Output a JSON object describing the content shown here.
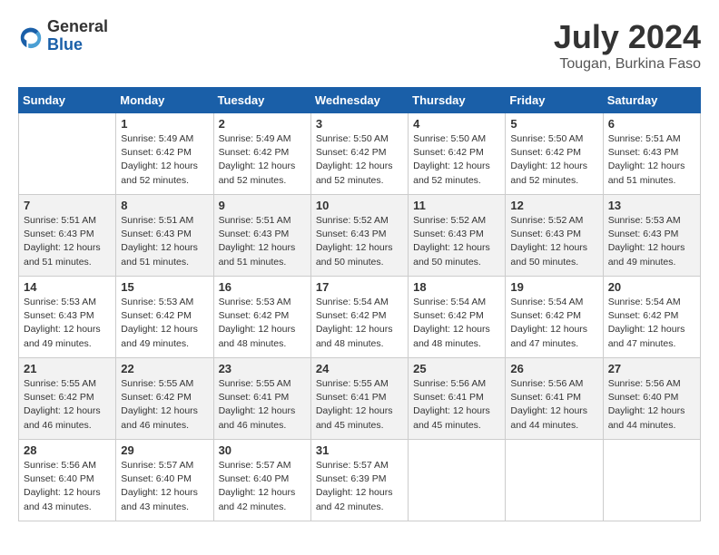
{
  "header": {
    "logo_line1": "General",
    "logo_line2": "Blue",
    "month_year": "July 2024",
    "location": "Tougan, Burkina Faso"
  },
  "days_of_week": [
    "Sunday",
    "Monday",
    "Tuesday",
    "Wednesday",
    "Thursday",
    "Friday",
    "Saturday"
  ],
  "weeks": [
    [
      {
        "day": "",
        "info": ""
      },
      {
        "day": "1",
        "info": "Sunrise: 5:49 AM\nSunset: 6:42 PM\nDaylight: 12 hours\nand 52 minutes."
      },
      {
        "day": "2",
        "info": "Sunrise: 5:49 AM\nSunset: 6:42 PM\nDaylight: 12 hours\nand 52 minutes."
      },
      {
        "day": "3",
        "info": "Sunrise: 5:50 AM\nSunset: 6:42 PM\nDaylight: 12 hours\nand 52 minutes."
      },
      {
        "day": "4",
        "info": "Sunrise: 5:50 AM\nSunset: 6:42 PM\nDaylight: 12 hours\nand 52 minutes."
      },
      {
        "day": "5",
        "info": "Sunrise: 5:50 AM\nSunset: 6:42 PM\nDaylight: 12 hours\nand 52 minutes."
      },
      {
        "day": "6",
        "info": "Sunrise: 5:51 AM\nSunset: 6:43 PM\nDaylight: 12 hours\nand 51 minutes."
      }
    ],
    [
      {
        "day": "7",
        "info": "Sunrise: 5:51 AM\nSunset: 6:43 PM\nDaylight: 12 hours\nand 51 minutes."
      },
      {
        "day": "8",
        "info": "Sunrise: 5:51 AM\nSunset: 6:43 PM\nDaylight: 12 hours\nand 51 minutes."
      },
      {
        "day": "9",
        "info": "Sunrise: 5:51 AM\nSunset: 6:43 PM\nDaylight: 12 hours\nand 51 minutes."
      },
      {
        "day": "10",
        "info": "Sunrise: 5:52 AM\nSunset: 6:43 PM\nDaylight: 12 hours\nand 50 minutes."
      },
      {
        "day": "11",
        "info": "Sunrise: 5:52 AM\nSunset: 6:43 PM\nDaylight: 12 hours\nand 50 minutes."
      },
      {
        "day": "12",
        "info": "Sunrise: 5:52 AM\nSunset: 6:43 PM\nDaylight: 12 hours\nand 50 minutes."
      },
      {
        "day": "13",
        "info": "Sunrise: 5:53 AM\nSunset: 6:43 PM\nDaylight: 12 hours\nand 49 minutes."
      }
    ],
    [
      {
        "day": "14",
        "info": "Sunrise: 5:53 AM\nSunset: 6:43 PM\nDaylight: 12 hours\nand 49 minutes."
      },
      {
        "day": "15",
        "info": "Sunrise: 5:53 AM\nSunset: 6:42 PM\nDaylight: 12 hours\nand 49 minutes."
      },
      {
        "day": "16",
        "info": "Sunrise: 5:53 AM\nSunset: 6:42 PM\nDaylight: 12 hours\nand 48 minutes."
      },
      {
        "day": "17",
        "info": "Sunrise: 5:54 AM\nSunset: 6:42 PM\nDaylight: 12 hours\nand 48 minutes."
      },
      {
        "day": "18",
        "info": "Sunrise: 5:54 AM\nSunset: 6:42 PM\nDaylight: 12 hours\nand 48 minutes."
      },
      {
        "day": "19",
        "info": "Sunrise: 5:54 AM\nSunset: 6:42 PM\nDaylight: 12 hours\nand 47 minutes."
      },
      {
        "day": "20",
        "info": "Sunrise: 5:54 AM\nSunset: 6:42 PM\nDaylight: 12 hours\nand 47 minutes."
      }
    ],
    [
      {
        "day": "21",
        "info": "Sunrise: 5:55 AM\nSunset: 6:42 PM\nDaylight: 12 hours\nand 46 minutes."
      },
      {
        "day": "22",
        "info": "Sunrise: 5:55 AM\nSunset: 6:42 PM\nDaylight: 12 hours\nand 46 minutes."
      },
      {
        "day": "23",
        "info": "Sunrise: 5:55 AM\nSunset: 6:41 PM\nDaylight: 12 hours\nand 46 minutes."
      },
      {
        "day": "24",
        "info": "Sunrise: 5:55 AM\nSunset: 6:41 PM\nDaylight: 12 hours\nand 45 minutes."
      },
      {
        "day": "25",
        "info": "Sunrise: 5:56 AM\nSunset: 6:41 PM\nDaylight: 12 hours\nand 45 minutes."
      },
      {
        "day": "26",
        "info": "Sunrise: 5:56 AM\nSunset: 6:41 PM\nDaylight: 12 hours\nand 44 minutes."
      },
      {
        "day": "27",
        "info": "Sunrise: 5:56 AM\nSunset: 6:40 PM\nDaylight: 12 hours\nand 44 minutes."
      }
    ],
    [
      {
        "day": "28",
        "info": "Sunrise: 5:56 AM\nSunset: 6:40 PM\nDaylight: 12 hours\nand 43 minutes."
      },
      {
        "day": "29",
        "info": "Sunrise: 5:57 AM\nSunset: 6:40 PM\nDaylight: 12 hours\nand 43 minutes."
      },
      {
        "day": "30",
        "info": "Sunrise: 5:57 AM\nSunset: 6:40 PM\nDaylight: 12 hours\nand 42 minutes."
      },
      {
        "day": "31",
        "info": "Sunrise: 5:57 AM\nSunset: 6:39 PM\nDaylight: 12 hours\nand 42 minutes."
      },
      {
        "day": "",
        "info": ""
      },
      {
        "day": "",
        "info": ""
      },
      {
        "day": "",
        "info": ""
      }
    ]
  ]
}
